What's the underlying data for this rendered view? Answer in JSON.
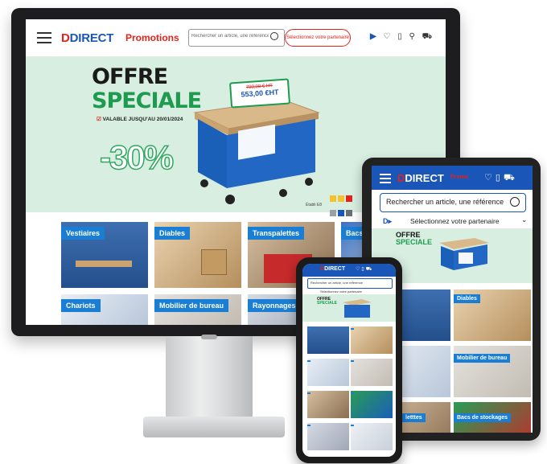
{
  "desktop": {
    "logo_mark": "D",
    "logo_text": "DIRECT",
    "promotions_label": "Promotions",
    "search_placeholder": "Rechercher un article, une référence",
    "partner_button": "Sélectionnez votre partenaire",
    "header_icons": [
      "heart-icon",
      "clipboard-icon",
      "user-icon",
      "cart-icon"
    ],
    "hero": {
      "line1": "OFFRE",
      "line2": "SPECIALE",
      "validity": "VALABLE JUSQU'AU 20/01/2024",
      "discount": "-30%",
      "old_price": "790,00 € HT",
      "new_price": "553,00 €HT",
      "swatch_label": "Établi E8",
      "swatch_colors": [
        "#f2c230",
        "#f2c230",
        "#e2231a",
        "#9aa0a6",
        "#1a56b8",
        "#6b6f74",
        "#f2c230"
      ]
    },
    "categories": [
      "Vestiaires",
      "Diables",
      "Transpalettes",
      "Bacs de",
      "Chariots",
      "Mobilier de bureau",
      "Rayonnages"
    ]
  },
  "tablet": {
    "logo_text": "DIRECT",
    "promotions_label": "Promo",
    "search_placeholder": "Rechercher un article, une référence",
    "partner_label": "Sélectionnez votre partenaire",
    "hero_line1": "OFFRE",
    "hero_line2": "SPECIALE",
    "categories": [
      "Diables",
      "Mobilier de bureau",
      "Bacs de stockages",
      "letttes"
    ]
  },
  "phone": {
    "logo_text": "DIRECT",
    "search_placeholder": "Rechercher un article, une référence",
    "partner_label": "Sélectionnez votre partenaire",
    "hero_line1": "OFFRE",
    "hero_line2": "SPECIALE"
  },
  "colors": {
    "brand_blue": "#1a56b8",
    "brand_red": "#e2231a",
    "hero_green": "#1e9b4f",
    "hero_bg": "#d8eee1"
  }
}
